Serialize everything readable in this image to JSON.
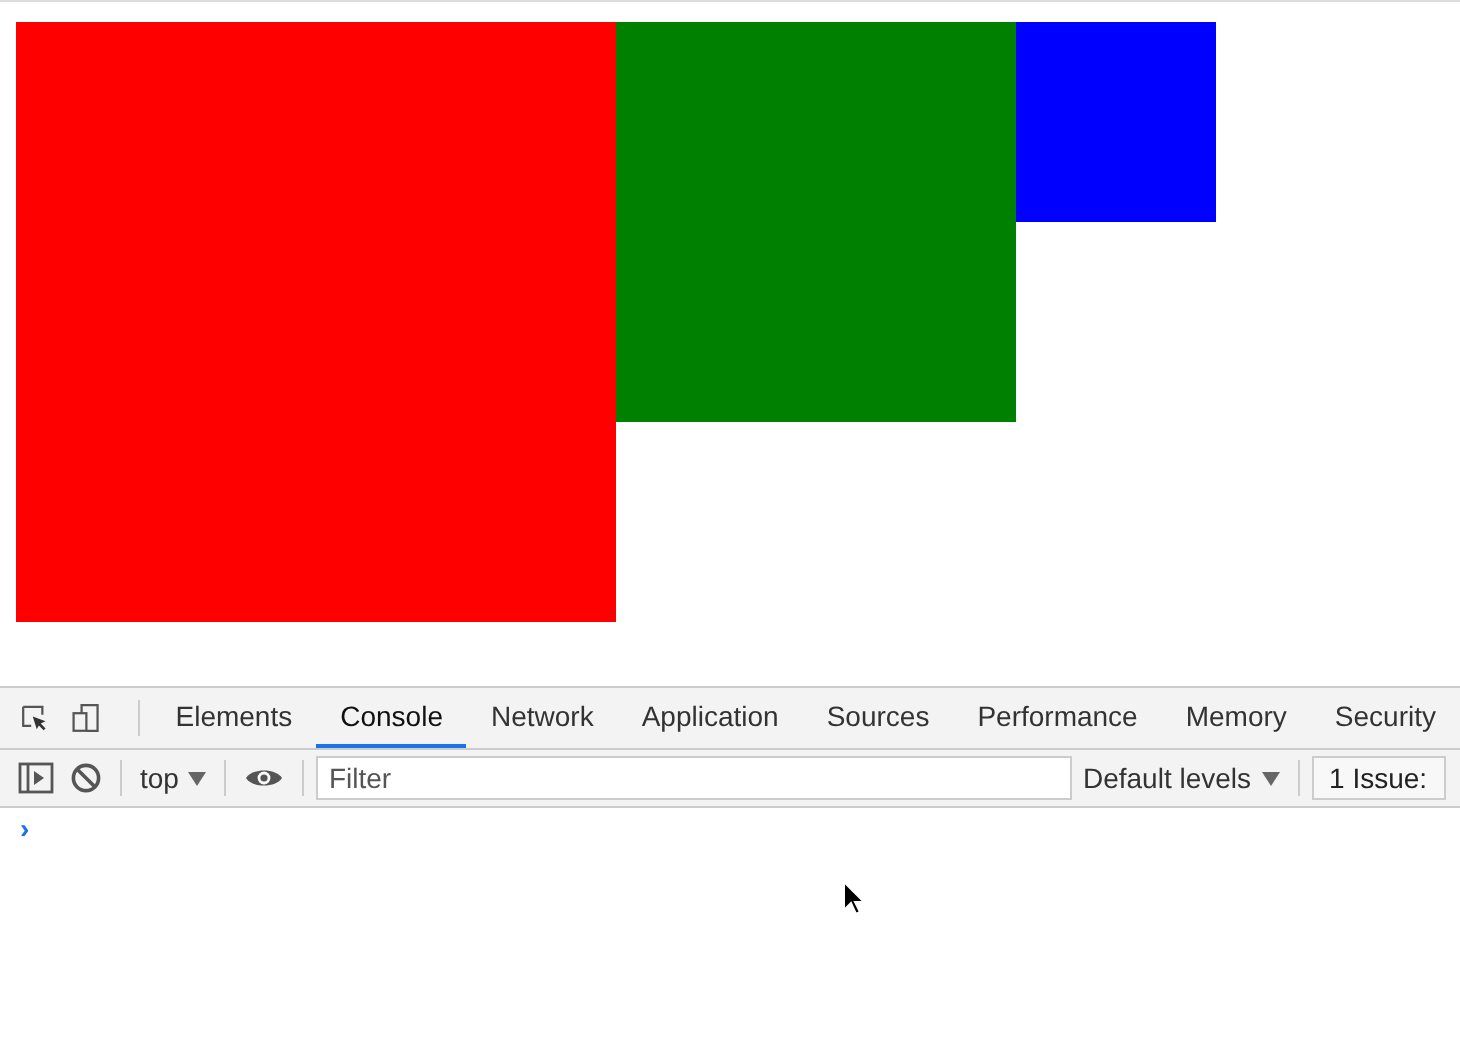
{
  "page": {
    "boxes": [
      {
        "color": "#ff0000"
      },
      {
        "color": "#008000"
      },
      {
        "color": "#0000ff"
      }
    ]
  },
  "devtools": {
    "tabs": [
      {
        "label": "Elements",
        "selected": false
      },
      {
        "label": "Console",
        "selected": true
      },
      {
        "label": "Network",
        "selected": false
      },
      {
        "label": "Application",
        "selected": false
      },
      {
        "label": "Sources",
        "selected": false
      },
      {
        "label": "Performance",
        "selected": false
      },
      {
        "label": "Memory",
        "selected": false
      },
      {
        "label": "Security",
        "selected": false
      }
    ],
    "toolbar": {
      "context": "top",
      "filter": {
        "placeholder": "Filter"
      },
      "levels": "Default levels",
      "issues": "1 Issue:"
    },
    "console": {
      "prompt": "›"
    }
  }
}
